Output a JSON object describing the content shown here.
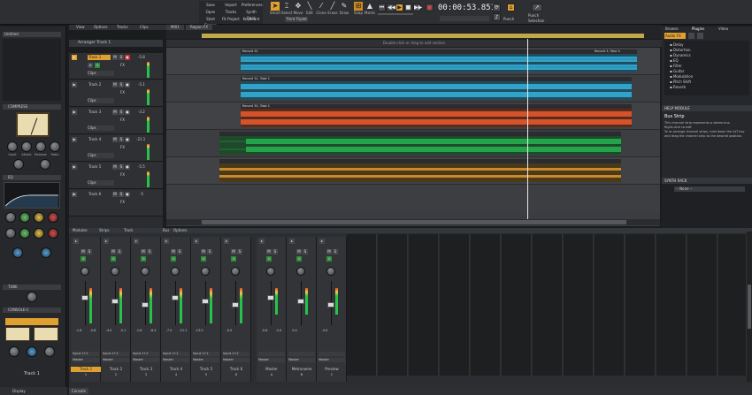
{
  "toolbar": {
    "menu": [
      [
        "Save",
        "Import",
        "Preferences"
      ],
      [
        "Open",
        "Tracks",
        "Synth Rack"
      ],
      [
        "Start Screen",
        "Fit Project",
        "Keyboard"
      ]
    ],
    "tools": [
      "Smart",
      "Select",
      "Move",
      "Edit",
      "Clone",
      "Erase",
      "Draw"
    ],
    "snap_label": "Snap",
    "marks_label": "Marks",
    "time": "00:00:53.851",
    "punch_label": "Punch",
    "selection_label": "Selection",
    "colors": {
      "accent": "#f0a030",
      "bg": "#2d2f32"
    }
  },
  "track_view": {
    "tabs": [
      "View",
      "Options",
      "Tracks",
      "Clips"
    ],
    "arranger_label": "Arranger Track 1",
    "arranger_sections": [
      "MIX1",
      "Region FX"
    ],
    "section_hint": "Double-click or drag to add section",
    "ruler": [
      "1",
      "3",
      "5",
      "7",
      "9",
      "11",
      "13",
      "15",
      "17",
      "19",
      "21",
      "23",
      "25",
      "27",
      "29",
      "31",
      "33",
      "35",
      "37"
    ],
    "tracks": [
      {
        "name": "Track 1",
        "vol": "-5.8",
        "fx": "FX",
        "clip": "Clips",
        "color": "#2fa3c9",
        "num": "1"
      },
      {
        "name": "Track 2",
        "vol": "-5.1",
        "fx": "FX",
        "clip": "Clips",
        "color": "#2fa3c9",
        "num": "2"
      },
      {
        "name": "Track 3",
        "vol": "-3.2",
        "fx": "FX",
        "clip": "Clips",
        "color": "#d4532a",
        "num": "3"
      },
      {
        "name": "Track 4",
        "vol": "-21.1",
        "fx": "FX",
        "clip": "Clips",
        "color": "#23a44a",
        "num": "4"
      },
      {
        "name": "Track 5",
        "vol": "-5.5",
        "fx": "FX",
        "clip": "Clips",
        "color": "#c98a2c",
        "num": "5"
      },
      {
        "name": "Track 6",
        "vol": "-5",
        "fx": "FX",
        "clip": "Clips",
        "color": "#888",
        "num": "6"
      }
    ],
    "clips": [
      {
        "name": "Record 31",
        "track": 0
      },
      {
        "name": "Record 3, Take 4",
        "track": 0
      },
      {
        "name": "Record 31, Take 1",
        "track": 1
      },
      {
        "name": "Record 30, Take 1",
        "track": 2
      }
    ]
  },
  "left_panel": {
    "preset": "Untitled",
    "compressor_label": "COMPRESS",
    "knob_labels": [
      "Input",
      "Attack",
      "Release",
      "Ratio",
      "Thresh",
      "Output"
    ],
    "eq_label": "EQ",
    "tube_label": "TUBE",
    "console_label": "CONSOLE-C",
    "track_label": "Track 1",
    "display_tab": "Display"
  },
  "right_panel": {
    "tabs": [
      "Browse",
      "Plugins",
      "Video"
    ],
    "plugin_filter": "Audio FX",
    "tree": [
      "Delay",
      "Distortion",
      "Dynamics",
      "EQ",
      "Filter",
      "Guitar",
      "Modulation",
      "Pitch Shift",
      "Reverb"
    ],
    "help_title": "HELP MODULE",
    "help_heading": "Bus Strip",
    "help_text1": "This channel strip represents a stereo bus.",
    "help_text2": "Right-click to edit",
    "help_text3": "To re-arrange channel strips, hold down the ALT key and drag the channel strip to the desired position.",
    "synth_title": "SYNTH RACK",
    "synth_value": "-- None --"
  },
  "console": {
    "tabs": [
      "Modules",
      "Strips",
      "Track",
      "Bus",
      "Options"
    ],
    "strips": [
      {
        "name": "Track 1",
        "num": "1",
        "l": "-1.6",
        "r": "-5.8",
        "out": "Master",
        "in": "Input 1+2"
      },
      {
        "name": "Track 2",
        "num": "2",
        "l": "-4.0",
        "r": "-5.1",
        "out": "Master",
        "in": "Input 1+2"
      },
      {
        "name": "Track 3",
        "num": "3",
        "l": "-1.6",
        "r": "-8.4",
        "out": "Master",
        "in": "Input 1+2"
      },
      {
        "name": "Track 4",
        "num": "4",
        "l": "-7.5",
        "r": "-21.1",
        "out": "Master",
        "in": "Input 1+2"
      },
      {
        "name": "Track 5",
        "num": "5",
        "l": "-13.0",
        "r": "",
        "out": "Master",
        "in": "Input 1+2"
      },
      {
        "name": "Track 6",
        "num": "6",
        "l": "-0.0",
        "r": "",
        "out": "Master",
        "in": "Input 1+2"
      },
      {
        "name": "Master",
        "num": "A",
        "l": "-0.6",
        "r": "-2.0",
        "out": "Master",
        "in": ""
      },
      {
        "name": "Metronome",
        "num": "B",
        "l": "0.0",
        "r": "",
        "out": "Master",
        "in": ""
      },
      {
        "name": "Preview",
        "num": "C",
        "l": "-3.0",
        "r": "",
        "out": "Master",
        "in": ""
      }
    ]
  },
  "bottom": {
    "tab": "Console"
  }
}
